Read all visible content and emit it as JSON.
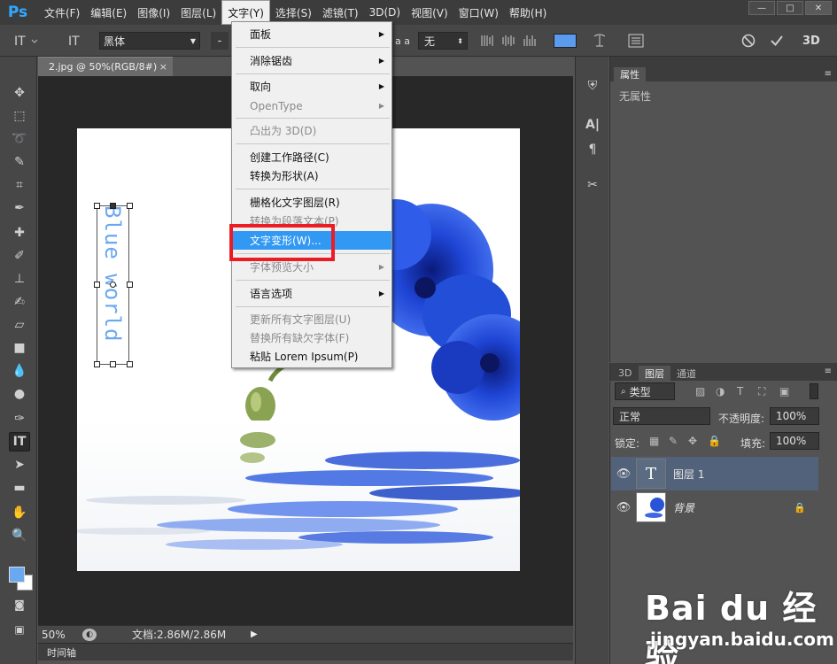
{
  "app": {
    "logo": "Ps"
  },
  "menubar": {
    "items": [
      "文件(F)",
      "编辑(E)",
      "图像(I)",
      "图层(L)",
      "文字(Y)",
      "选择(S)",
      "滤镜(T)",
      "3D(D)",
      "视图(V)",
      "窗口(W)",
      "帮助(H)"
    ],
    "active_index": 4
  },
  "window_controls": {
    "minimize": "—",
    "maximize": "□",
    "close": "✕"
  },
  "options_bar": {
    "font_family": "黑体",
    "dash": "-",
    "aa_label": "a a",
    "antialias": "无",
    "color": "#5b9bef"
  },
  "document": {
    "tab_title": "2.jpg @ 50%(RGB/8#)",
    "vertical_text": "Blue world"
  },
  "status_bar": {
    "zoom": "50%",
    "doc_info": "文档:2.86M/2.86M",
    "timeline_label": "时间轴"
  },
  "properties_panel": {
    "tab": "属性",
    "body_text": "无属性"
  },
  "layers_panel": {
    "tabs": [
      "3D",
      "图层",
      "通道"
    ],
    "active_tab": 1,
    "filter_kind": "类型",
    "blend_mode": "正常",
    "opacity_label": "不透明度:",
    "opacity_value": "100%",
    "lock_label": "锁定:",
    "fill_label": "填充:",
    "fill_value": "100%",
    "layers": [
      {
        "name": "图层 1",
        "type": "text",
        "selected": true
      },
      {
        "name": "背景",
        "type": "image",
        "locked": true
      }
    ]
  },
  "text_menu": {
    "items": [
      {
        "label": "面板",
        "submenu": true,
        "disabled": false
      },
      {
        "label": "消除锯齿",
        "submenu": true,
        "disabled": false
      },
      {
        "label": "取向",
        "submenu": true,
        "disabled": false
      },
      {
        "label": "OpenType",
        "submenu": true,
        "disabled": true
      },
      {
        "label": "凸出为 3D(D)",
        "submenu": false,
        "disabled": true
      },
      {
        "label": "创建工作路径(C)",
        "submenu": false,
        "disabled": false
      },
      {
        "label": "转换为形状(A)",
        "submenu": false,
        "disabled": false
      },
      {
        "label": "栅格化文字图层(R)",
        "submenu": false,
        "disabled": false
      },
      {
        "label": "转换为段落文本(P)",
        "submenu": false,
        "disabled": true
      },
      {
        "label": "文字变形(W)...",
        "submenu": false,
        "disabled": false,
        "highlighted": true
      },
      {
        "label": "字体预览大小",
        "submenu": true,
        "disabled": true
      },
      {
        "label": "语言选项",
        "submenu": true,
        "disabled": false
      },
      {
        "label": "更新所有文字图层(U)",
        "submenu": false,
        "disabled": true
      },
      {
        "label": "替换所有缺欠字体(F)",
        "submenu": false,
        "disabled": true
      },
      {
        "label": "粘贴 Lorem Ipsum(P)",
        "submenu": false,
        "disabled": false
      }
    ]
  },
  "watermark": {
    "logo": "Bai du 经验",
    "url": "jingyan.baidu.com"
  },
  "colors": {
    "accent": "#3199f3",
    "highlight_box": "#ec1c24",
    "selected_layer": "#52627a"
  }
}
